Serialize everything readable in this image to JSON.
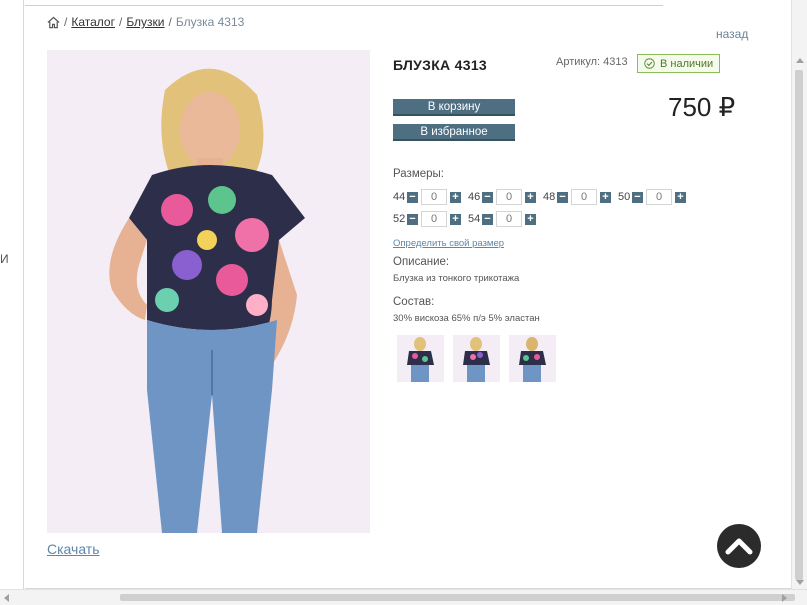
{
  "breadcrumb": {
    "home_icon": "home-icon",
    "sep": "/",
    "catalog": "Каталог",
    "category": "Блузки",
    "current": "Блузка 4313"
  },
  "left_fragment": "И",
  "back_label": "назад",
  "product": {
    "title": "БЛУЗКА 4313",
    "sku": "Артикул: 4313",
    "stock": "В наличии",
    "price": "750 ₽",
    "add_to_cart": "В корзину",
    "add_to_favorites": "В избранное",
    "sizes_label": "Размеры:",
    "sizes": [
      {
        "size": "44",
        "qty": "0"
      },
      {
        "size": "46",
        "qty": "0"
      },
      {
        "size": "48",
        "qty": "0"
      },
      {
        "size": "50",
        "qty": "0"
      },
      {
        "size": "52",
        "qty": "0"
      },
      {
        "size": "54",
        "qty": "0"
      }
    ],
    "size_link": "Определить свой размер",
    "description_label": "Описание:",
    "description": "Блузка из тонкого трикотажа",
    "composition_label": "Состав:",
    "composition": "30% вискоза 65% п/э 5% эластан",
    "download": "Скачать"
  },
  "colors": {
    "button": "#4e6f82",
    "stock_border": "#8bbd55",
    "link": "#5e86a8"
  }
}
